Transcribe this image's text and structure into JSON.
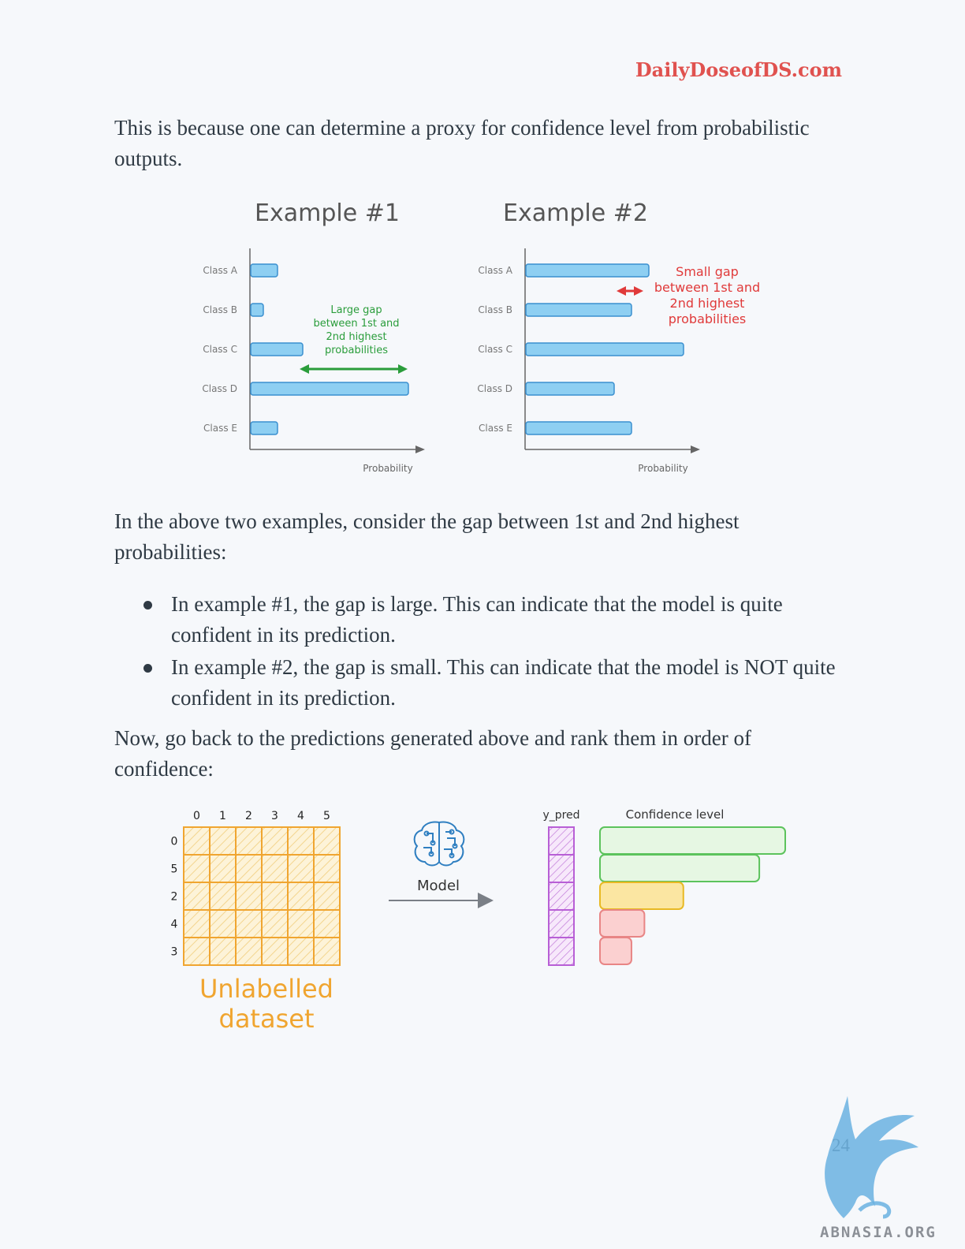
{
  "header": {
    "brand": "DailyDoseofDS.com"
  },
  "intro_paragraph": "This is because one can determine a proxy for confidence level from probabilistic outputs.",
  "figure1": {
    "examples": [
      {
        "title": "Example #1",
        "annotation": [
          "Large gap",
          "between 1st and",
          "2nd highest",
          "probabilities"
        ],
        "annotation_color": "#2a9d3b"
      },
      {
        "title": "Example #2",
        "annotation": [
          "Small gap",
          "between 1st and",
          "2nd highest",
          "probabilities"
        ],
        "annotation_color": "#e03a3a"
      }
    ]
  },
  "chart_data": [
    {
      "type": "bar",
      "title": "Example #1",
      "xlabel": "Probability",
      "categories": [
        "Class A",
        "Class B",
        "Class C",
        "Class D",
        "Class E"
      ],
      "values": [
        0.17,
        0.08,
        0.33,
        1.0,
        0.17
      ],
      "bar_color": "#8ecff2"
    },
    {
      "type": "bar",
      "title": "Example #2",
      "xlabel": "Probability",
      "categories": [
        "Class A",
        "Class B",
        "Class C",
        "Class D",
        "Class E"
      ],
      "values": [
        0.78,
        0.67,
        1.0,
        0.56,
        0.67
      ],
      "bar_color": "#8ecff2"
    }
  ],
  "middle_paragraph": "In the above two examples, consider the gap between 1st and 2nd highest probabilities:",
  "bullets": [
    "In example #1, the gap is large. This can indicate that the model is quite confident in its prediction.",
    "In example #2, the gap is small. This can indicate that the model is NOT quite confident in its prediction."
  ],
  "closing_paragraph": "Now, go back to the predictions generated above and rank them in order of confidence:",
  "figure2": {
    "column_headers": [
      "0",
      "1",
      "2",
      "3",
      "4",
      "5"
    ],
    "row_headers": [
      "0",
      "5",
      "2",
      "4",
      "3"
    ],
    "dataset_label": [
      "Unlabelled",
      "dataset"
    ],
    "model_label": "Model",
    "ypred_label": "y_pred",
    "confidence_label": "Confidence level",
    "confidence_levels": [
      1.0,
      0.86,
      0.45,
      0.24,
      0.17
    ],
    "confidence_colors": [
      {
        "fill": "#e6f7e3",
        "stroke": "#5cc35c"
      },
      {
        "fill": "#e6f7e3",
        "stroke": "#5cc35c"
      },
      {
        "fill": "#fbe6a2",
        "stroke": "#e8b923"
      },
      {
        "fill": "#fbd0d0",
        "stroke": "#e88585"
      },
      {
        "fill": "#fbd0d0",
        "stroke": "#e88585"
      }
    ],
    "grid_color": "#f0a530",
    "ypred_color": "#b85fd6"
  },
  "footer": {
    "page_number": "24",
    "watermark": "ABNASIA.ORG"
  }
}
